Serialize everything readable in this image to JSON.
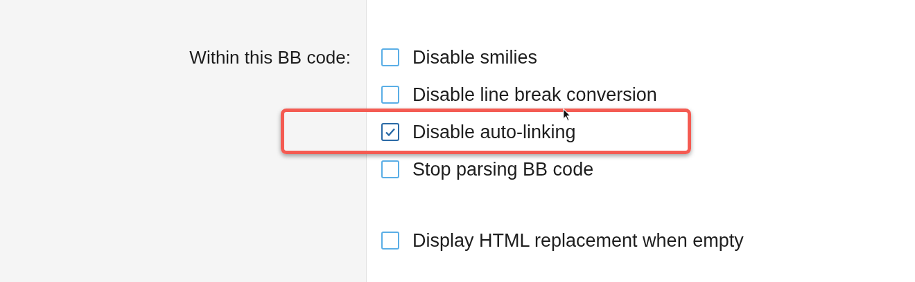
{
  "label": "Within this BB code:",
  "groups": [
    {
      "options": [
        {
          "label": "Disable smilies",
          "checked": false,
          "highlighted": false
        },
        {
          "label": "Disable line break conversion",
          "checked": false,
          "highlighted": false
        },
        {
          "label": "Disable auto-linking",
          "checked": true,
          "highlighted": true
        },
        {
          "label": "Stop parsing BB code",
          "checked": false,
          "highlighted": false
        }
      ]
    },
    {
      "options": [
        {
          "label": "Display HTML replacement when empty",
          "checked": false,
          "highlighted": false
        }
      ]
    }
  ]
}
